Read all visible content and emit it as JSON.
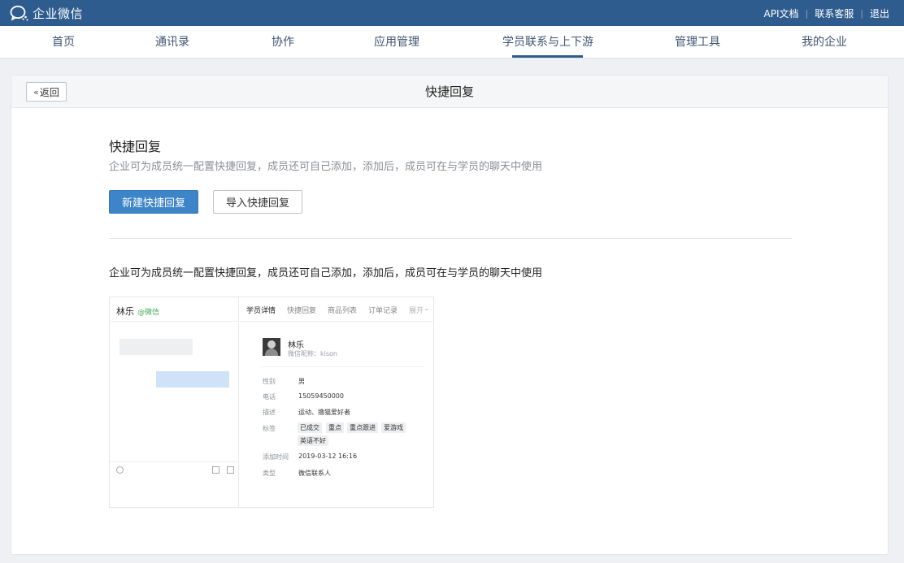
{
  "app": {
    "logo_text": "企业微信"
  },
  "top_links": {
    "api_docs": "API文档",
    "contact_support": "联系客服",
    "logout": "退出"
  },
  "nav": {
    "items": [
      {
        "label": "首页"
      },
      {
        "label": "通讯录"
      },
      {
        "label": "协作"
      },
      {
        "label": "应用管理"
      },
      {
        "label": "学员联系与上下游"
      },
      {
        "label": "管理工具"
      },
      {
        "label": "我的企业"
      }
    ],
    "active_index": 4
  },
  "panel": {
    "back_label": "返回",
    "title": "快捷回复"
  },
  "section": {
    "title": "快捷回复",
    "description": "企业可为成员统一配置快捷回复，成员还可自己添加，添加后，成员可在与学员的聊天中使用",
    "new_button": "新建快捷回复",
    "import_button": "导入快捷回复",
    "description2": "企业可为成员统一配置快捷回复，成员还可自己添加，添加后，成员可在与学员的聊天中使用"
  },
  "preview": {
    "chat_name": "林乐",
    "chat_source": "@微信",
    "tabs": [
      "学员详情",
      "快捷回复",
      "商品列表",
      "订单记录",
      "展开"
    ],
    "profile_name": "林乐",
    "profile_nick": "微信昵称：kison",
    "fields": {
      "gender_label": "性别",
      "gender_value": "男",
      "phone_label": "电话",
      "phone_value": "15059450000",
      "desc_label": "描述",
      "desc_value": "运动、撸猫爱好者",
      "tags_label": "标签",
      "added_label": "添加时间",
      "added_value": "2019-03-12 16:16",
      "type_label": "类型",
      "type_value": "微信联系人"
    },
    "tags": [
      "已成交",
      "重点",
      "重点跟进",
      "爱游戏",
      "英语不好"
    ]
  },
  "colors": {
    "topbar": "#2f5c8f",
    "primary": "#3d85c8",
    "wechat_green": "#3eae50"
  }
}
